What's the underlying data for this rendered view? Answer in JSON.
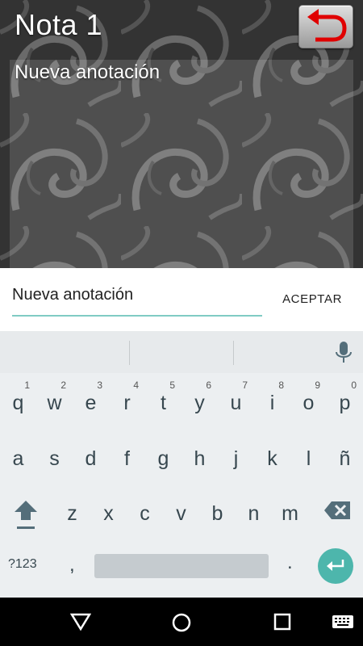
{
  "app": {
    "title": "Nota 1",
    "note_text": "Nueva anotación"
  },
  "dialog": {
    "input_value": "Nueva anotación",
    "accept_label": "ACEPTAR",
    "accent_color": "#80cbc4"
  },
  "keyboard": {
    "row1": [
      {
        "key": "q",
        "hint": "1"
      },
      {
        "key": "w",
        "hint": "2"
      },
      {
        "key": "e",
        "hint": "3"
      },
      {
        "key": "r",
        "hint": "4"
      },
      {
        "key": "t",
        "hint": "5"
      },
      {
        "key": "y",
        "hint": "6"
      },
      {
        "key": "u",
        "hint": "7"
      },
      {
        "key": "i",
        "hint": "8"
      },
      {
        "key": "o",
        "hint": "9"
      },
      {
        "key": "p",
        "hint": "0"
      }
    ],
    "row2": [
      "a",
      "s",
      "d",
      "f",
      "g",
      "h",
      "j",
      "k",
      "l",
      "ñ"
    ],
    "row3": [
      "z",
      "x",
      "c",
      "v",
      "b",
      "n",
      "m"
    ],
    "symbols_label": "?123",
    "comma": ",",
    "period": ".",
    "enter_color": "#4db6ac",
    "icons": [
      "mic-icon",
      "shift-icon",
      "backspace-icon",
      "enter-icon"
    ]
  },
  "navbar": {
    "icons": [
      "back-triangle-icon",
      "home-circle-icon",
      "recents-square-icon",
      "keyboard-switch-icon"
    ]
  }
}
